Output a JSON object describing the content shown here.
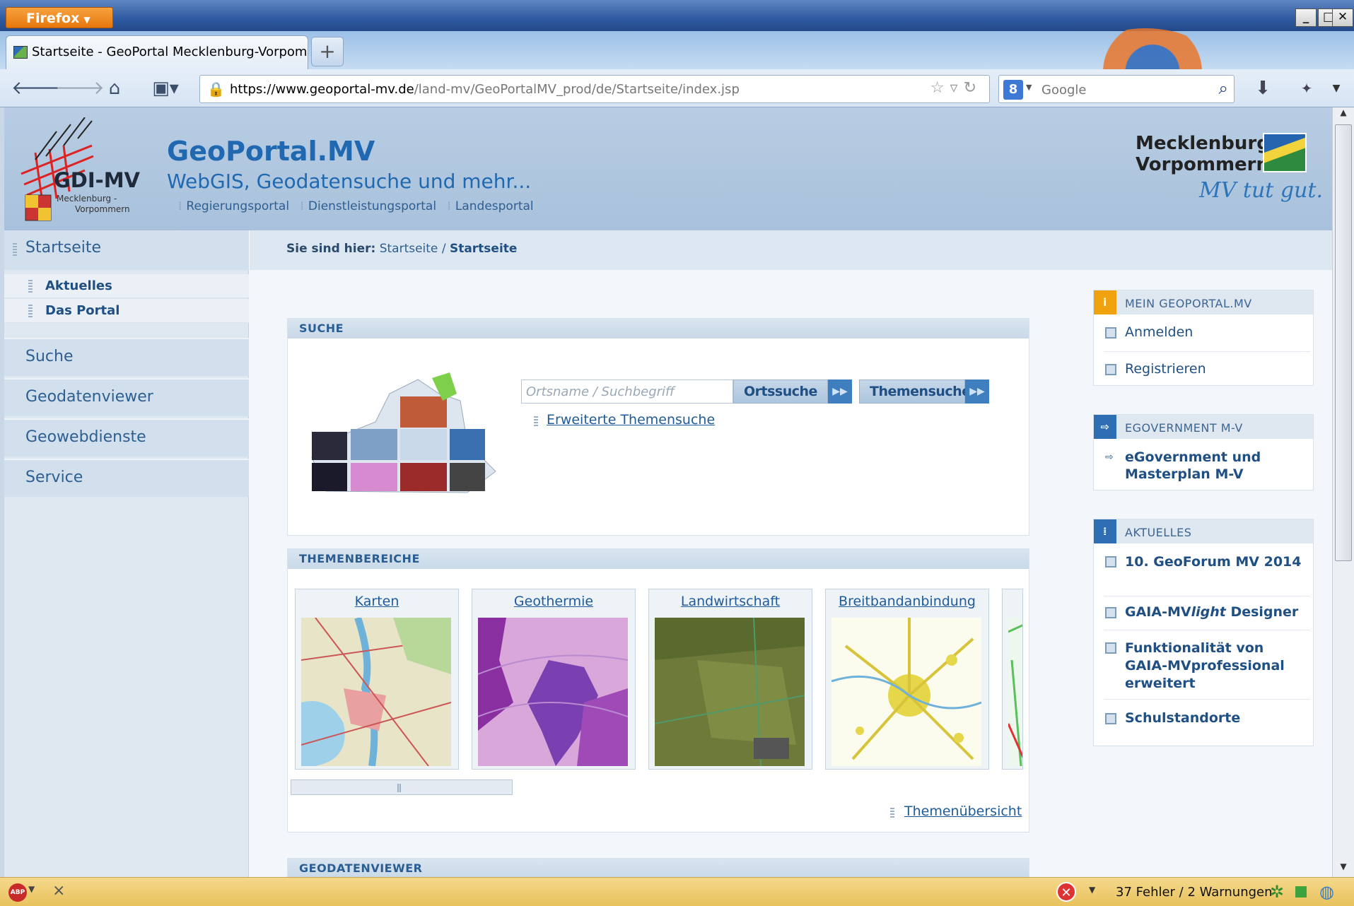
{
  "browser": {
    "menu_button": "Firefox",
    "window_controls": {
      "minimize": "_",
      "maximize": "□",
      "close": "✕"
    },
    "tab_title": "Startseite - GeoPortal Mecklenburg-Vorpom...",
    "new_tab": "+",
    "url_domain": "https://www.geoportal-mv.de",
    "url_path": "/land-mv/GeoPortalMV_prod/de/Startseite/index.jsp",
    "search_engine": "8",
    "search_placeholder": "Google"
  },
  "header": {
    "logo_title": "GDI-MV",
    "logo_sub1": "Mecklenburg -",
    "logo_sub2": "Vorpommern",
    "site_title": "GeoPortal.MV",
    "site_subtitle": "WebGIS, Geodatensuche und mehr...",
    "links": [
      "Regierungsportal",
      "Dienstleistungsportal",
      "Landesportal"
    ],
    "state_logo_line1": "Mecklenburg",
    "state_logo_line2": "Vorpommern",
    "state_slogan": "MV tut gut."
  },
  "left_nav": {
    "top": "Startseite",
    "sub_items": [
      "Aktuelles",
      "Das Portal"
    ],
    "main_items": [
      "Suche",
      "Geodatenviewer",
      "Geowebdienste",
      "Service"
    ]
  },
  "breadcrumb": {
    "label": "Sie sind hier:",
    "items": [
      "Startseite",
      "Startseite"
    ],
    "separator": "/"
  },
  "search_box": {
    "title": "SUCHE",
    "input_placeholder": "Ortsname / Suchbegriff",
    "btn_ortsuche": "Ortssuche",
    "btn_themensuche": "Themensuche",
    "extended_link": "Erweiterte Themensuche"
  },
  "themes_box": {
    "title": "THEMENBEREICHE",
    "cards": [
      "Karten",
      "Geothermie",
      "Landwirtschaft",
      "Breitbandanbindung"
    ],
    "overview_link": "Themenübersicht"
  },
  "viewer_box": {
    "title": "GEODATENVIEWER"
  },
  "right_col": {
    "mein": {
      "title": "MEIN GEOPORTAL.MV",
      "icon": "i",
      "items": [
        "Anmelden",
        "Registrieren"
      ]
    },
    "egov": {
      "title": "EGOVERNMENT M-V",
      "items": [
        "eGovernment und Masterplan M-V"
      ]
    },
    "news": {
      "title": "AKTUELLES",
      "items": [
        "10. GeoForum MV 2014",
        "GAIA-MV",
        "light",
        " Designer",
        "Funktionalität von GAIA-MVprofessional erweitert",
        "Schulstandorte"
      ]
    }
  },
  "statusbar": {
    "abp": "ABP",
    "errors": "37 Fehler / 2 Warnungen"
  },
  "colors": {
    "accent_blue": "#2069b1",
    "nav_bg": "#d2dfec",
    "info_orange": "#f0a20e",
    "header_bg": "#b8cde3"
  }
}
